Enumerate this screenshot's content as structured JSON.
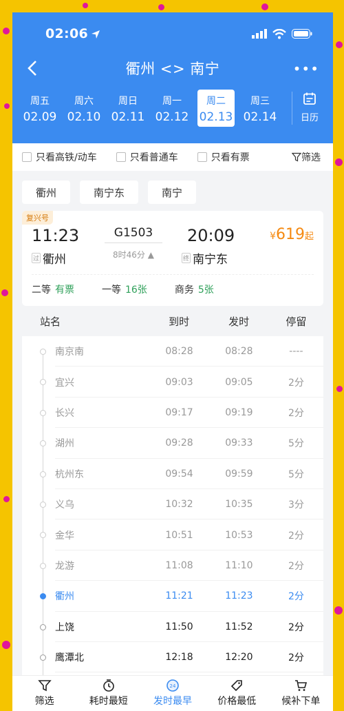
{
  "status": {
    "time": "02:06"
  },
  "header": {
    "title": "衢州 <> 南宁",
    "more": "•••"
  },
  "dates": [
    {
      "weekday": "周五",
      "date": "02.09"
    },
    {
      "weekday": "周六",
      "date": "02.10"
    },
    {
      "weekday": "周日",
      "date": "02.11"
    },
    {
      "weekday": "周一",
      "date": "02.12"
    },
    {
      "weekday": "周二",
      "date": "02.13",
      "active": true
    },
    {
      "weekday": "周三",
      "date": "02.14"
    }
  ],
  "calendar_label": "日历",
  "filters": {
    "high_speed": "只看高铁/动车",
    "normal": "只看普通车",
    "available": "只看有票",
    "screen": "筛选"
  },
  "station_chips": [
    "衢州",
    "南宁东",
    "南宁"
  ],
  "train": {
    "tag": "复兴号",
    "depart_time": "11:23",
    "arrive_time": "20:09",
    "number": "G1503",
    "duration": "8时46分",
    "duration_arrow": "▲",
    "depart_badge": "过",
    "depart_station": "衢州",
    "arrive_badge": "终",
    "arrive_station": "南宁东",
    "price_currency": "¥",
    "price": "619",
    "price_suffix": "起",
    "seats": [
      {
        "class": "二等",
        "value": "有票"
      },
      {
        "class": "一等",
        "value": "16张"
      },
      {
        "class": "商务",
        "value": "5张"
      }
    ]
  },
  "table": {
    "headers": {
      "name": "站名",
      "arrive": "到时",
      "depart": "发时",
      "stop": "停留"
    },
    "rows": [
      {
        "name": "南京南",
        "arrive": "08:28",
        "depart": "08:28",
        "stop": "----",
        "state": "past"
      },
      {
        "name": "宜兴",
        "arrive": "09:03",
        "depart": "09:05",
        "stop": "2分",
        "state": "past"
      },
      {
        "name": "长兴",
        "arrive": "09:17",
        "depart": "09:19",
        "stop": "2分",
        "state": "past"
      },
      {
        "name": "湖州",
        "arrive": "09:28",
        "depart": "09:33",
        "stop": "5分",
        "state": "past"
      },
      {
        "name": "杭州东",
        "arrive": "09:54",
        "depart": "09:59",
        "stop": "5分",
        "state": "past"
      },
      {
        "name": "义乌",
        "arrive": "10:32",
        "depart": "10:35",
        "stop": "3分",
        "state": "past"
      },
      {
        "name": "金华",
        "arrive": "10:51",
        "depart": "10:53",
        "stop": "2分",
        "state": "past"
      },
      {
        "name": "龙游",
        "arrive": "11:08",
        "depart": "11:10",
        "stop": "2分",
        "state": "past"
      },
      {
        "name": "衢州",
        "arrive": "11:21",
        "depart": "11:23",
        "stop": "2分",
        "state": "current"
      },
      {
        "name": "上饶",
        "arrive": "11:50",
        "depart": "11:52",
        "stop": "2分",
        "state": "future"
      },
      {
        "name": "鹰潭北",
        "arrive": "12:18",
        "depart": "12:20",
        "stop": "2分",
        "state": "future"
      }
    ]
  },
  "tabbar": [
    {
      "label": "筛选",
      "icon": "funnel-icon"
    },
    {
      "label": "耗时最短",
      "icon": "timer-icon"
    },
    {
      "label": "发时最早",
      "icon": "clock-24-icon",
      "active": true
    },
    {
      "label": "价格最低",
      "icon": "price-tag-icon"
    },
    {
      "label": "候补下单",
      "icon": "cart-icon"
    }
  ]
}
